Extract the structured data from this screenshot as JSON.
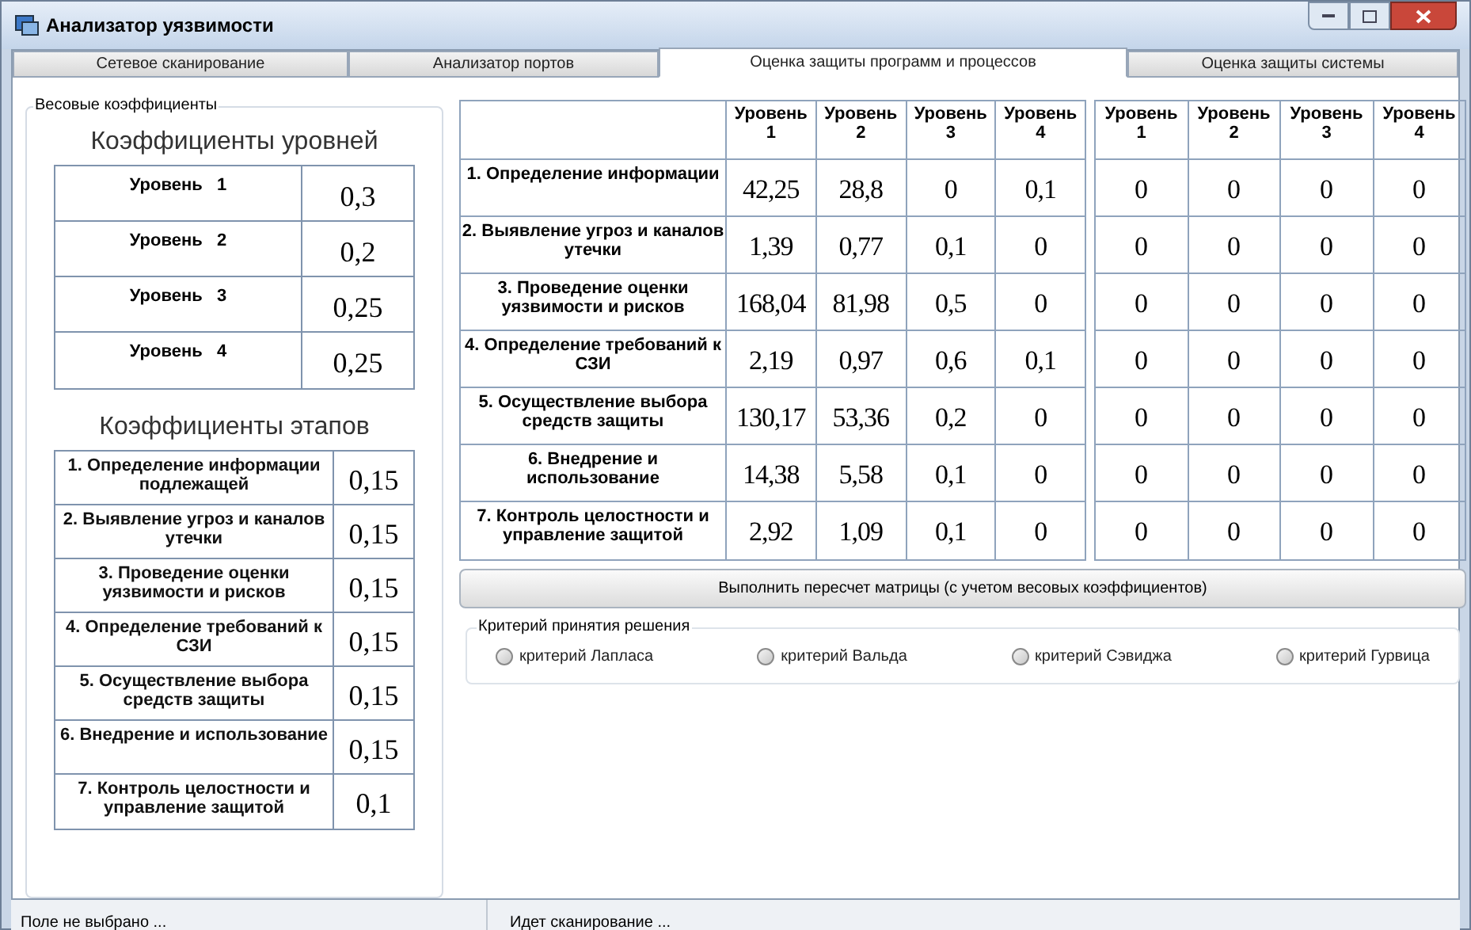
{
  "window": {
    "title": "Анализатор уязвимости"
  },
  "tabs": [
    {
      "label": "Сетевое сканирование",
      "selected": false
    },
    {
      "label": "Анализатор портов",
      "selected": false
    },
    {
      "label": "Оценка защиты программ и процессов",
      "selected": true
    },
    {
      "label": "Оценка защиты системы",
      "selected": false
    }
  ],
  "weights": {
    "title": "Весовые коэффициенты",
    "levels_title": "Коэффициенты уровней",
    "levels": [
      {
        "label": "Уровень   1",
        "value": "0,3"
      },
      {
        "label": "Уровень   2",
        "value": "0,2"
      },
      {
        "label": "Уровень   3",
        "value": "0,25"
      },
      {
        "label": "Уровень   4",
        "value": "0,25"
      }
    ],
    "stages_title": "Коэффициенты этапов",
    "stages": [
      {
        "label": "1. Определение информации подлежащей",
        "value": "0,15"
      },
      {
        "label": "2. Выявление угроз и каналов утечки",
        "value": "0,15"
      },
      {
        "label": "3. Проведение оценки уязвимости и рисков",
        "value": "0,15"
      },
      {
        "label": "4. Определение требований к СЗИ",
        "value": "0,15"
      },
      {
        "label": "5. Осуществление выбора средств защиты",
        "value": "0,15"
      },
      {
        "label": "6. Внедрение и использование",
        "value": "0,15"
      },
      {
        "label": "7. Контроль целостности и управление защитой",
        "value": "0,1"
      }
    ]
  },
  "matrix": {
    "columns": [
      "Уровень 1",
      "Уровень 2",
      "Уровень 3",
      "Уровень 4"
    ],
    "rows": [
      {
        "label": "1. Определение информации",
        "values": [
          "42,25",
          "28,8",
          "0",
          "0,1"
        ]
      },
      {
        "label": "2. Выявление угроз и каналов утечки",
        "values": [
          "1,39",
          "0,77",
          "0,1",
          "0"
        ]
      },
      {
        "label": "3. Проведение оценки уязвимости и рисков",
        "values": [
          "168,04",
          "81,98",
          "0,5",
          "0"
        ]
      },
      {
        "label": "4. Определение требований к СЗИ",
        "values": [
          "2,19",
          "0,97",
          "0,6",
          "0,1"
        ]
      },
      {
        "label": "5. Осуществление выбора средств защиты",
        "values": [
          "130,17",
          "53,36",
          "0,2",
          "0"
        ]
      },
      {
        "label": "6. Внедрение и использование",
        "values": [
          "14,38",
          "5,58",
          "0,1",
          "0"
        ]
      },
      {
        "label": "7. Контроль целостности и управление защитой",
        "values": [
          "2,92",
          "1,09",
          "0,1",
          "0"
        ]
      }
    ]
  },
  "result": {
    "columns": [
      "Уровень 1",
      "Уровень 2",
      "Уровень 3",
      "Уровень 4"
    ],
    "rows": [
      [
        "0",
        "0",
        "0",
        "0"
      ],
      [
        "0",
        "0",
        "0",
        "0"
      ],
      [
        "0",
        "0",
        "0",
        "0"
      ],
      [
        "0",
        "0",
        "0",
        "0"
      ],
      [
        "0",
        "0",
        "0",
        "0"
      ],
      [
        "0",
        "0",
        "0",
        "0"
      ],
      [
        "0",
        "0",
        "0",
        "0"
      ]
    ]
  },
  "recalc_button": "Выполнить пересчет матрицы (с учетом весовых коэффициентов)",
  "criteria": {
    "title": "Критерий принятия решения",
    "options": [
      {
        "label": "критерий Лапласа",
        "selected": false
      },
      {
        "label": "критерий Вальда",
        "selected": false
      },
      {
        "label": "критерий Сэвиджа",
        "selected": false
      },
      {
        "label": "критерий Гурвица",
        "selected": false
      }
    ]
  },
  "status_bar": [
    "Поле не выбрано ...",
    "Идет сканирование ..."
  ]
}
